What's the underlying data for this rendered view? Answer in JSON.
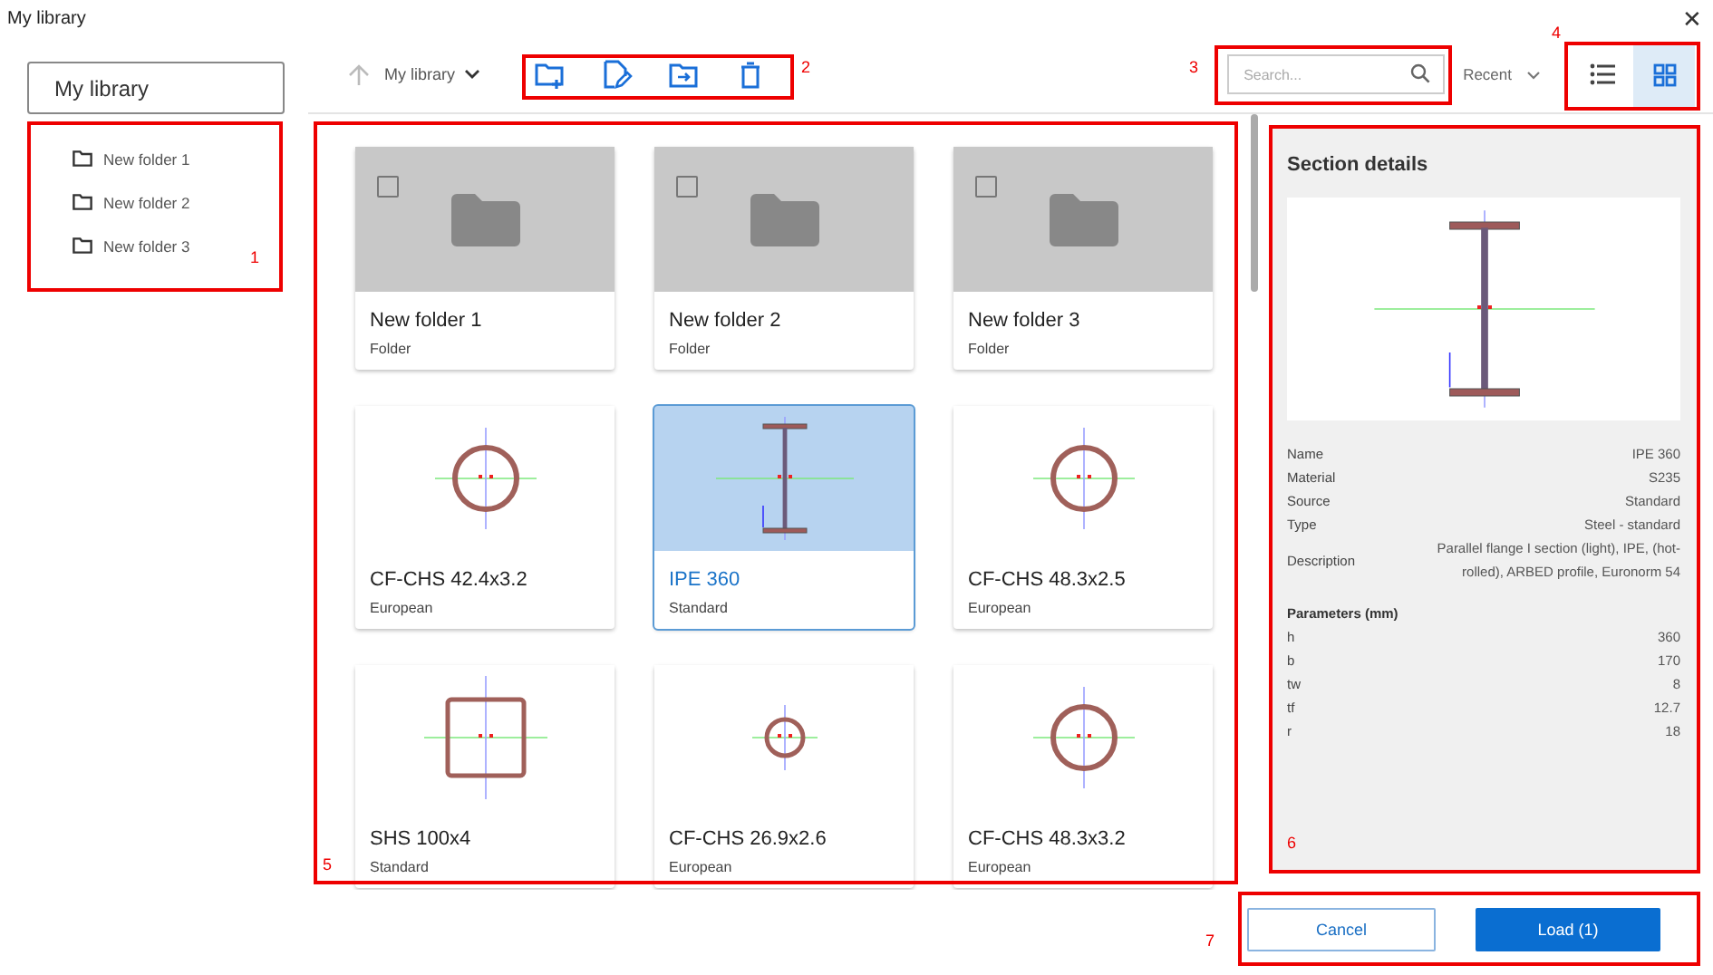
{
  "window": {
    "title": "My library",
    "close": "✕"
  },
  "sidebar": {
    "root": "My library",
    "items": [
      {
        "label": "New folder 1"
      },
      {
        "label": "New folder 2"
      },
      {
        "label": "New folder 3"
      }
    ]
  },
  "toolbar": {
    "breadcrumb": "My library",
    "search": {
      "placeholder": "Search..."
    },
    "sort": "Recent",
    "views": [
      {
        "kind": "list",
        "selected": false
      },
      {
        "kind": "grid",
        "selected": true
      }
    ]
  },
  "cards": [
    {
      "kind": "folder",
      "title": "New folder 1",
      "subtitle": "Folder",
      "selected": false,
      "checked": false
    },
    {
      "kind": "folder",
      "title": "New folder 2",
      "subtitle": "Folder",
      "selected": false,
      "checked": false
    },
    {
      "kind": "folder",
      "title": "New folder 3",
      "subtitle": "Folder",
      "selected": false,
      "checked": false
    },
    {
      "kind": "circle",
      "title": "CF-CHS 42.4x3.2",
      "subtitle": "European",
      "selected": false
    },
    {
      "kind": "ibeam",
      "title": "IPE 360",
      "subtitle": "Standard",
      "selected": true
    },
    {
      "kind": "circle",
      "title": "CF-CHS 48.3x2.5",
      "subtitle": "European",
      "selected": false
    },
    {
      "kind": "square",
      "title": "SHS 100x4",
      "subtitle": "Standard",
      "selected": false
    },
    {
      "kind": "smallcircle",
      "title": "CF-CHS 26.9x2.6",
      "subtitle": "European",
      "selected": false
    },
    {
      "kind": "circle",
      "title": "CF-CHS 48.3x3.2",
      "subtitle": "European",
      "selected": false
    }
  ],
  "details": {
    "title": "Section details",
    "kind": "ibeam",
    "properties": [
      {
        "label": "Name",
        "value": "IPE 360"
      },
      {
        "label": "Material",
        "value": "S235"
      },
      {
        "label": "Source",
        "value": "Standard"
      },
      {
        "label": "Type",
        "value": "Steel - standard"
      },
      {
        "label": "Description",
        "value": "Parallel flange I section (light), IPE, (hot-rolled), ARBED profile, Euronorm 54"
      }
    ],
    "parameters_title": "Parameters (mm)",
    "parameters": [
      {
        "label": "h",
        "value": "360"
      },
      {
        "label": "b",
        "value": "170"
      },
      {
        "label": "tw",
        "value": "8"
      },
      {
        "label": "tf",
        "value": "12.7"
      },
      {
        "label": "r",
        "value": "18"
      }
    ]
  },
  "buttons": [
    {
      "label": "Cancel",
      "kind": "secondary"
    },
    {
      "label": "Load (1)",
      "kind": "primary"
    }
  ],
  "annotations": [
    "1",
    "2",
    "3",
    "4",
    "5",
    "6",
    "7"
  ]
}
